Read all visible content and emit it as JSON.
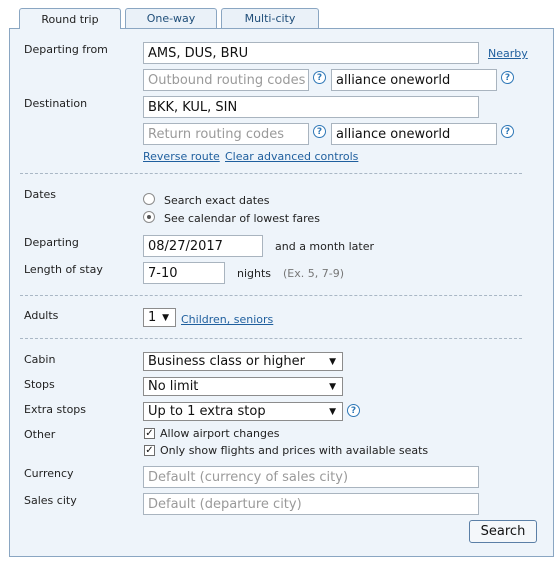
{
  "tabs": [
    {
      "label": "Round trip",
      "active": true
    },
    {
      "label": "One-way",
      "active": false
    },
    {
      "label": "Multi-city",
      "active": false
    }
  ],
  "route": {
    "departing_label": "Departing from",
    "departing_value": "AMS, DUS, BRU",
    "nearby_link": "Nearby",
    "outbound_routing_placeholder": "Outbound routing codes",
    "outbound_extension_value": "alliance oneworld",
    "destination_label": "Destination",
    "destination_value": "BKK, KUL, SIN",
    "return_routing_placeholder": "Return routing codes",
    "return_extension_value": "alliance oneworld",
    "reverse_route_link": "Reverse route",
    "clear_advanced_link": "Clear advanced controls"
  },
  "dates": {
    "label": "Dates",
    "option_exact": "Search exact dates",
    "option_calendar": "See calendar of lowest fares",
    "selected": "calendar",
    "departing_label": "Departing",
    "departing_value": "08/27/2017",
    "departing_suffix": "and a month later",
    "stay_label": "Length of stay",
    "stay_value": "7-10",
    "stay_unit": "nights",
    "stay_hint": "(Ex. 5, 7-9)"
  },
  "passengers": {
    "adults_label": "Adults",
    "adults_value": "1",
    "children_link": "Children, seniors"
  },
  "options": {
    "cabin_label": "Cabin",
    "cabin_value": "Business class or higher",
    "stops_label": "Stops",
    "stops_value": "No limit",
    "extra_stops_label": "Extra stops",
    "extra_stops_value": "Up to 1 extra stop",
    "other_label": "Other",
    "allow_airport_changes": "Allow airport changes",
    "allow_airport_changes_checked": true,
    "available_seats": "Only show flights and prices with available seats",
    "available_seats_checked": true,
    "currency_label": "Currency",
    "currency_placeholder": "Default (currency of sales city)",
    "sales_city_label": "Sales city",
    "sales_city_placeholder": "Default (departure city)"
  },
  "search_button": "Search",
  "colors": {
    "panel_bg": "#eef4fa",
    "border": "#8aa6c2",
    "link": "#1f5f9e",
    "help_icon": "#2f78b7"
  },
  "icons": {
    "help": "question-circle-icon",
    "dropdown": "chevron-down-icon",
    "check": "check-mark-icon"
  }
}
